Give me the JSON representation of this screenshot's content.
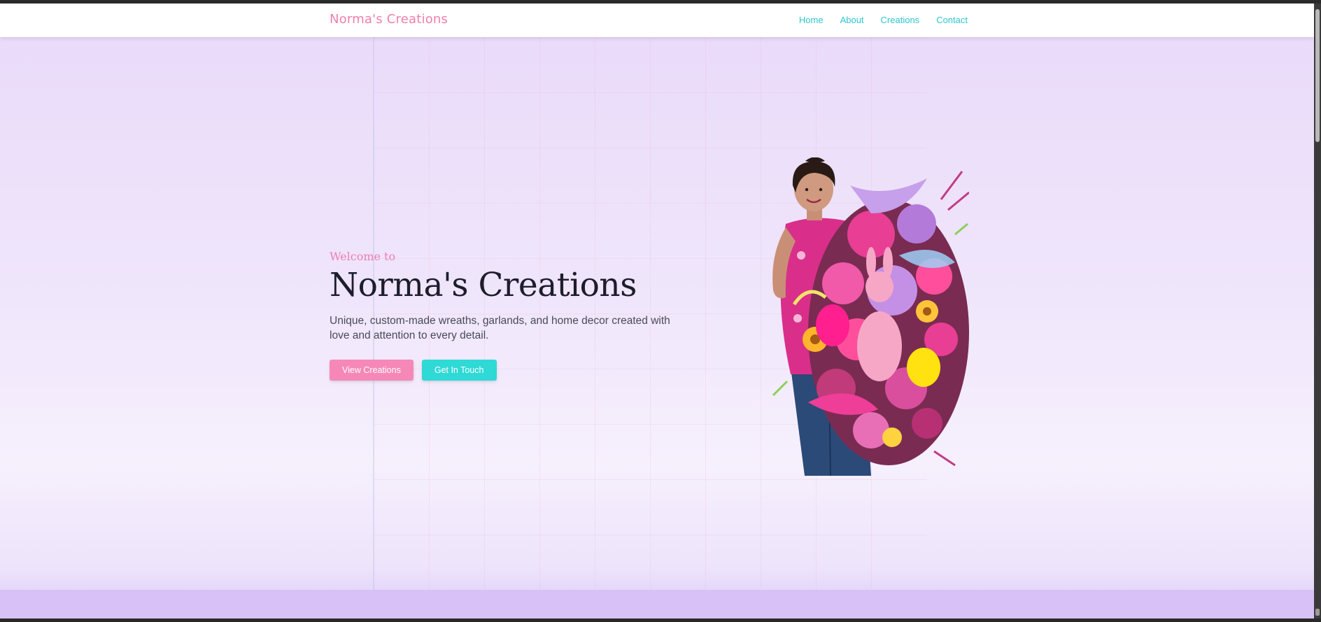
{
  "navbar": {
    "brand": "Norma's Creations",
    "links": [
      "Home",
      "About",
      "Creations",
      "Contact"
    ]
  },
  "hero": {
    "welcome": "Welcome to",
    "title": "Norma's Creations",
    "description": "Unique, custom-made wreaths, garlands, and home decor created with love and attention to every detail.",
    "primary_button": "View Creations",
    "secondary_button": "Get In Touch",
    "image": "woman-holding-floral-wreath"
  },
  "colors": {
    "brand_pink": "#f07fae",
    "nav_teal": "#2cc7d0",
    "button_pink": "#f688b8",
    "button_teal": "#2fd9d5",
    "background_lavender": "#e9daf9",
    "bottom_band": "#d7c1f7"
  }
}
